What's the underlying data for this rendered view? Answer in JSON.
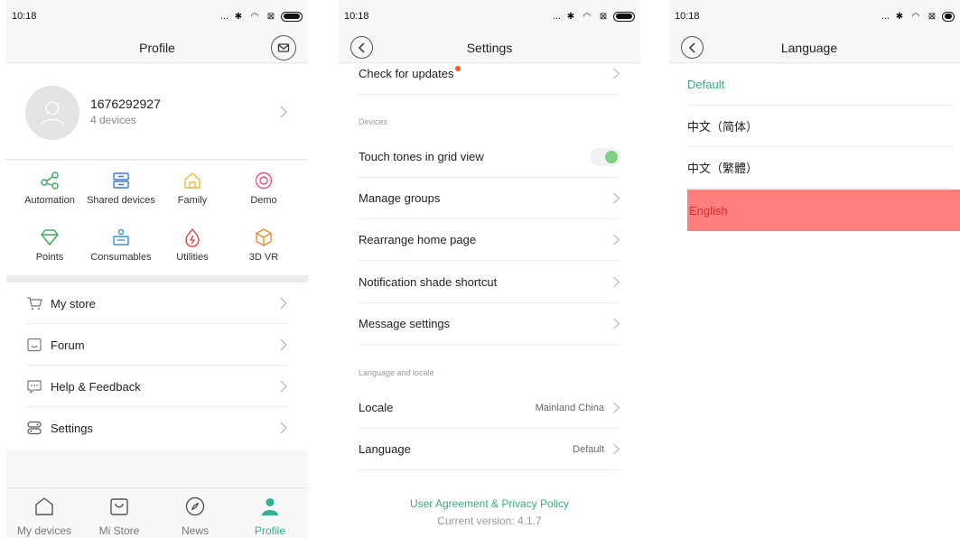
{
  "status": {
    "time": "10:18",
    "dots": "...",
    "bluetooth": "✱",
    "wifi": "◠",
    "sim": "⊠"
  },
  "profile": {
    "title": "Profile",
    "account": {
      "id": "1676292927",
      "devices": "4 devices"
    },
    "grid": [
      {
        "label": "Automation",
        "icon": "automation-icon",
        "color": "#3aaa5a"
      },
      {
        "label": "Shared devices",
        "icon": "shared-devices-icon",
        "color": "#3b79d6"
      },
      {
        "label": "Family",
        "icon": "family-icon",
        "color": "#f0b62d"
      },
      {
        "label": "Demo",
        "icon": "demo-icon",
        "color": "#ef4f7a"
      },
      {
        "label": "Points",
        "icon": "points-icon",
        "color": "#3aaa5a"
      },
      {
        "label": "Consumables",
        "icon": "consumables-icon",
        "color": "#3a8fd6"
      },
      {
        "label": "Utilities",
        "icon": "utilities-icon",
        "color": "#e24343"
      },
      {
        "label": "3D VR",
        "icon": "vr-icon",
        "color": "#f08a2d"
      }
    ],
    "menu": [
      {
        "label": "My store",
        "icon": "cart-icon"
      },
      {
        "label": "Forum",
        "icon": "forum-icon"
      },
      {
        "label": "Help & Feedback",
        "icon": "feedback-icon"
      },
      {
        "label": "Settings",
        "icon": "settings-icon"
      }
    ],
    "tabs": [
      {
        "label": "My devices",
        "icon": "home-icon"
      },
      {
        "label": "Mi Store",
        "icon": "bag-icon"
      },
      {
        "label": "News",
        "icon": "compass-icon"
      },
      {
        "label": "Profile",
        "icon": "person-icon"
      }
    ],
    "accent": "#2db38f"
  },
  "settings": {
    "title": "Settings",
    "check_updates": "Check for updates",
    "devices_header": "Devices",
    "touch_tones": "Touch tones in grid view",
    "manage_groups": "Manage groups",
    "rearrange": "Rearrange home page",
    "notif_shortcut": "Notification shade shortcut",
    "message_settings": "Message settings",
    "lang_header": "Language and locale",
    "locale_label": "Locale",
    "locale_value": "Mainland China",
    "language_label": "Language",
    "language_value": "Default",
    "agreement": "User Agreement & Privacy Policy",
    "version": "Current version: 4.1.7"
  },
  "language": {
    "title": "Language",
    "options": [
      "Default",
      "中文（简体）",
      "中文（繁體）",
      "English"
    ]
  }
}
